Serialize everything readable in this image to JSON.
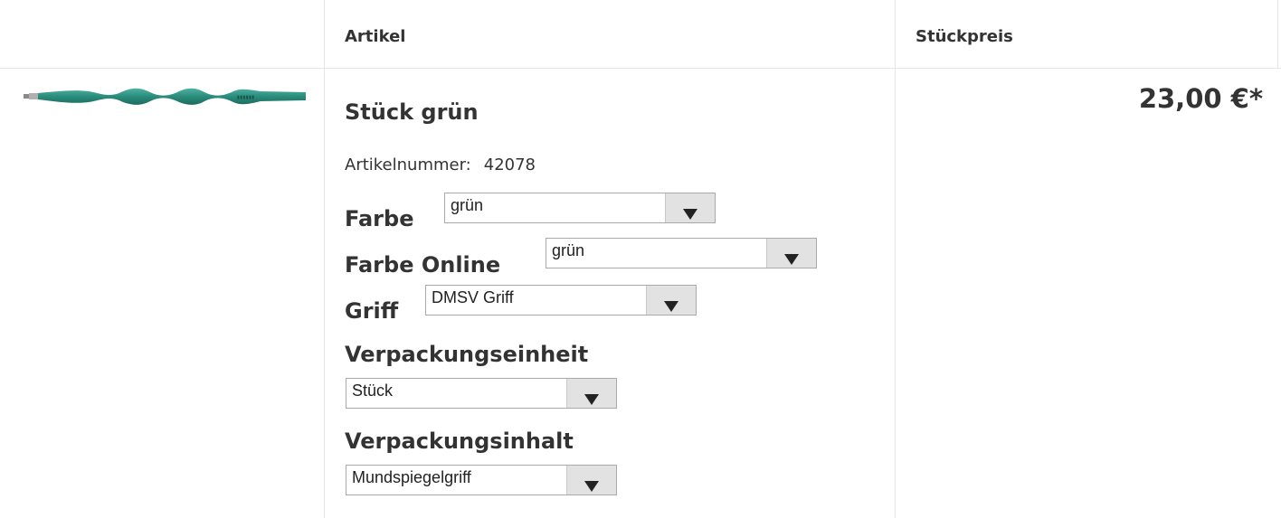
{
  "table": {
    "header": {
      "col_image": "",
      "col_article": "Artikel",
      "col_price": "Stückpreis"
    }
  },
  "product": {
    "title": "Stück grün",
    "article_number_label": "Artikelnummer:",
    "article_number": "42078",
    "price": "23,00 €*",
    "image_icon": "green-dental-mirror-handle-image",
    "options": {
      "farbe": {
        "label": "Farbe",
        "value": "grün"
      },
      "farbe_online": {
        "label": "Farbe Online",
        "value": "grün"
      },
      "griff": {
        "label": "Griff",
        "value": "DMSV Griff"
      },
      "verpackungseinheit": {
        "label": "Verpackungseinheit",
        "value": "Stück"
      },
      "verpackungsinhalt": {
        "label": "Verpackungsinhalt",
        "value": "Mundspiegelgriff"
      }
    }
  },
  "colors": {
    "border": "#e6e6e6",
    "text": "#333333",
    "product_green": "#2a8c7c"
  }
}
